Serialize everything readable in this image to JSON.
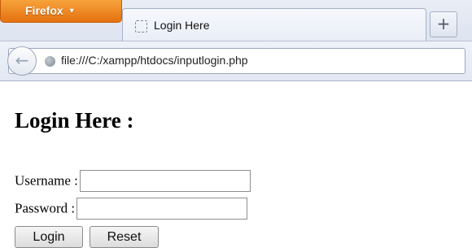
{
  "browser": {
    "menu_button_label": "Firefox",
    "menu_arrow": "▼",
    "tab_title": "Login Here",
    "new_tab_label": "+",
    "back_label": "←",
    "url": "file:///C:/xampp/htdocs/inputlogin.php"
  },
  "page": {
    "heading": "Login Here :",
    "username_label": "Username :",
    "username_value": "",
    "password_label": "Password :",
    "password_value": "",
    "login_button": "Login",
    "reset_button": "Reset"
  },
  "colors": {
    "firefox_orange": "#e5700f",
    "chrome_background": "#dde4f0"
  }
}
